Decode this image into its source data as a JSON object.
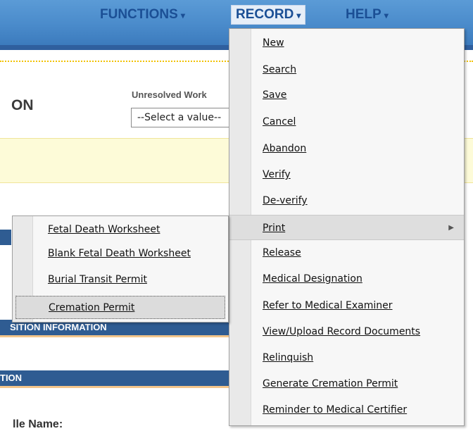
{
  "nav": {
    "functions": "FUNCTIONS",
    "record": "RECORD",
    "help": "HELP",
    "caret": "▾"
  },
  "page": {
    "title": "ON",
    "unresolved_label": "Unresolved Work",
    "select_value": "--Select a value--",
    "section_two": "SITION INFORMATION",
    "section_three": "TION",
    "name_label": "lle Name:"
  },
  "record_menu": {
    "items": [
      "New",
      "Search",
      "Save",
      "Cancel",
      "Abandon",
      "Verify",
      "De-verify",
      "Print",
      "Release",
      "Medical Designation",
      "Refer to Medical Examiner",
      "View/Upload Record Documents",
      "Relinquish",
      "Generate Cremation Permit",
      "Reminder to Medical Certifier"
    ],
    "submenu_arrow": "▶"
  },
  "print_menu": {
    "items": [
      "Fetal Death Worksheet",
      "Blank Fetal Death Worksheet",
      "Burial Transit Permit",
      "Cremation Permit"
    ]
  },
  "colors": {
    "nav_bg": "#4a8bcb",
    "nav_text": "#1b4f95",
    "section_bar": "#2f5c92",
    "notice_bg": "#fdfbd8",
    "dotted_rule": "#f2c200"
  }
}
